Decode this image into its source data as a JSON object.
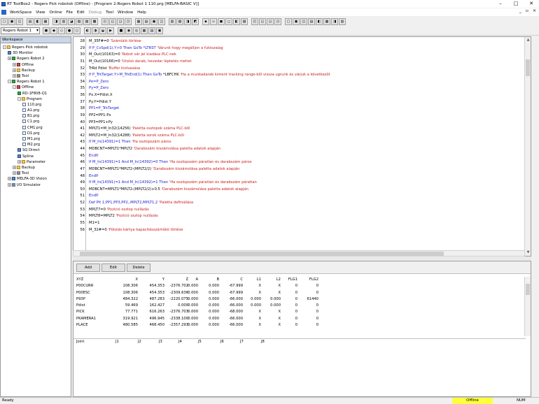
{
  "window": {
    "title": "RT ToolBox2 - Rogers Pick robotok  (Offline) - [Program 2:Rogers Robot 1 110.prg  [MELFA-BASIC V]]",
    "min": "–",
    "max": "□",
    "close": "✕"
  },
  "menu": {
    "items": [
      "WorkSpace",
      "View",
      "Online",
      "File",
      "Edit",
      "Debug",
      "Tool",
      "Window",
      "Help"
    ],
    "mdi_min": "_",
    "mdi_restore": "▫",
    "mdi_close": "×"
  },
  "toolbar": {
    "robot_select": "Rogers Robot 1"
  },
  "workspace": {
    "header": "Workspace",
    "tree": [
      {
        "label": "Rogers Pick robotok",
        "level": 0,
        "icon": "folder",
        "exp": "-"
      },
      {
        "label": "3D Monitor",
        "level": 1,
        "icon": "mon",
        "exp": ""
      },
      {
        "label": "Rogers Robot 2",
        "level": 1,
        "icon": "robot",
        "exp": "+"
      },
      {
        "label": "Offline",
        "level": 2,
        "icon": "plug",
        "exp": "+"
      },
      {
        "label": "Backup",
        "level": 2,
        "icon": "folder",
        "exp": "+"
      },
      {
        "label": "Tool",
        "level": 2,
        "icon": "tool",
        "exp": "+"
      },
      {
        "label": "Rogers Robot 1",
        "level": 1,
        "icon": "robot",
        "exp": "-"
      },
      {
        "label": "Offline",
        "level": 2,
        "icon": "plug",
        "exp": "-"
      },
      {
        "label": "RD-1F808-Q1",
        "level": 3,
        "icon": "robot",
        "exp": ""
      },
      {
        "label": "Program",
        "level": 3,
        "icon": "folder",
        "exp": "-"
      },
      {
        "label": "110.prg",
        "level": 4,
        "icon": "file",
        "exp": ""
      },
      {
        "label": "A1.prg",
        "level": 4,
        "icon": "file",
        "exp": ""
      },
      {
        "label": "B1.prg",
        "level": 4,
        "icon": "file",
        "exp": ""
      },
      {
        "label": "C1.prg",
        "level": 4,
        "icon": "file",
        "exp": ""
      },
      {
        "label": "CM1.prg",
        "level": 4,
        "icon": "file",
        "exp": ""
      },
      {
        "label": "D1.prg",
        "level": 4,
        "icon": "file",
        "exp": ""
      },
      {
        "label": "M1.prg",
        "level": 4,
        "icon": "file",
        "exp": ""
      },
      {
        "label": "M2.prg",
        "level": 4,
        "icon": "file",
        "exp": ""
      },
      {
        "label": "SQ Direct",
        "level": 3,
        "icon": "mon",
        "exp": ""
      },
      {
        "label": "Spline",
        "level": 3,
        "icon": "mon",
        "exp": ""
      },
      {
        "label": "Parameter",
        "level": 3,
        "icon": "folder",
        "exp": "+"
      },
      {
        "label": "Backup",
        "level": 2,
        "icon": "folder",
        "exp": "+"
      },
      {
        "label": "Tool",
        "level": 2,
        "icon": "tool",
        "exp": "+"
      },
      {
        "label": "MELFA-3D Vision",
        "level": 1,
        "icon": "mon",
        "exp": "+"
      },
      {
        "label": "I/O Simulator",
        "level": 1,
        "icon": "sim",
        "exp": "+"
      }
    ]
  },
  "code": [
    {
      "n": "28",
      "parts": [
        [
          "M_35F#=0 ",
          ""
        ],
        [
          "'Számláló törlése",
          "cm"
        ]
      ]
    },
    {
      "n": "29",
      "parts": [
        [
          "If P_CvSpd(1).Y>0 ",
          "kw"
        ],
        [
          "Then GoTo *LTRST ",
          "kw"
        ],
        [
          "'Várunk hogy megálljon a futószalag",
          "cm"
        ]
      ]
    },
    {
      "n": "30",
      "parts": [
        [
          "M_Out(10163)=0 ",
          ""
        ],
        [
          "'Robot vár jel kiadása PLC-nek",
          "cm"
        ]
      ]
    },
    {
      "n": "31",
      "parts": [
        [
          "M_Out(10166)=0 ",
          ""
        ],
        [
          "'Utolsó darab, hevedar léptetés mehet",
          "cm"
        ]
      ]
    },
    {
      "n": "32",
      "parts": [
        [
          "TrRd Pdist ",
          ""
        ],
        [
          "'Buffer kiolvasása",
          "cm"
        ]
      ]
    },
    {
      "n": "33",
      "parts": [
        [
          "If P_TrkTarget.Y>M_TrkEnd(1) Then GoTo ",
          "kw"
        ],
        [
          "*LBFCHK ",
          ""
        ],
        [
          "'Ha a munkadarab kiment tracking range-ből vissza ugrunk és várjuk a következőt",
          "cm"
        ]
      ]
    },
    {
      "n": "34",
      "parts": [
        [
          "Pe=P_Zero",
          "kw"
        ]
      ]
    },
    {
      "n": "35",
      "parts": [
        [
          "Py=P_Zero",
          "kw"
        ]
      ]
    },
    {
      "n": "36",
      "parts": [
        [
          "Px.X=Pdist.X",
          ""
        ]
      ]
    },
    {
      "n": "37",
      "parts": [
        [
          "Py.Y=Pdist.Y",
          ""
        ]
      ]
    },
    {
      "n": "38",
      "parts": [
        [
          "PP1=P_TrkTarget",
          "kw"
        ]
      ]
    },
    {
      "n": "39",
      "parts": [
        [
          "PP2=PP1-Px",
          ""
        ]
      ]
    },
    {
      "n": "40",
      "parts": [
        [
          "PP3=PP1+Py",
          ""
        ]
      ]
    },
    {
      "n": "41",
      "parts": [
        [
          "MPLT1=M_In32(14256) ",
          ""
        ],
        [
          "'Paletta oszlopok száma PLC-ből",
          "cm"
        ]
      ]
    },
    {
      "n": "42",
      "parts": [
        [
          "MPLT2=M_In32(14288) ",
          ""
        ],
        [
          "'Paletta sorok száma PLC-ből",
          "cm"
        ]
      ]
    },
    {
      "n": "43",
      "parts": [
        [
          "If M_In(14391)=1 ",
          "kw"
        ],
        [
          "Then ",
          "kw"
        ],
        [
          "'Ha oszlopszám páros",
          "cm"
        ]
      ]
    },
    {
      "n": "44",
      "parts": [
        [
          " MDBCNT=MPLT1*MPLT2 ",
          ""
        ],
        [
          "'Darabszám kiszámolása paletta adatok alapján",
          "cm"
        ]
      ]
    },
    {
      "n": "45",
      "parts": [
        [
          "EndIf",
          "kw"
        ]
      ]
    },
    {
      "n": "46",
      "parts": [
        [
          "If M_In(14391)=1 And M_In(14392)=0 ",
          "kw"
        ],
        [
          "Then ",
          "kw"
        ],
        [
          "'Ha oszlopszám páratlan és darabszám páros",
          "cm"
        ]
      ]
    },
    {
      "n": "47",
      "parts": [
        [
          " MDBCNT=MPLT1*MPLT2-(MPLT2/2) ",
          ""
        ],
        [
          "'Darabszám kiszámolása paletta adatok alapján",
          "cm"
        ]
      ]
    },
    {
      "n": "48",
      "parts": [
        [
          "EndIf",
          "kw"
        ]
      ]
    },
    {
      "n": "49",
      "parts": [
        [
          "If M_In(14391)=1 And M_In(14392)=1 ",
          "kw"
        ],
        [
          "Then ",
          "kw"
        ],
        [
          "'Ha oszlopszám páratlan és darabszám páratlan",
          "cm"
        ]
      ]
    },
    {
      "n": "50",
      "parts": [
        [
          " MDBCNT=MPLT1*MPLT2-(MPLT2/2)+0.5 ",
          ""
        ],
        [
          "'Darabszám kiszámolása paletta adatok alapján",
          "cm"
        ]
      ]
    },
    {
      "n": "51",
      "parts": [
        [
          "EndIf",
          "kw"
        ]
      ]
    },
    {
      "n": "52",
      "parts": [
        [
          "Def Plt 1,PP1,PP3,PP2,,MPLT2,MPLT1,2 ",
          "kw"
        ],
        [
          "'Paletta definiálása",
          "cm"
        ]
      ]
    },
    {
      "n": "53",
      "parts": [
        [
          "MPLT7=0 ",
          ""
        ],
        [
          "'Pozíció oszlop nullázás",
          "cm"
        ]
      ]
    },
    {
      "n": "54",
      "parts": [
        [
          "MPLT8=MPLT2 ",
          ""
        ],
        [
          "'Pozíció oszlop nullázás",
          "cm"
        ]
      ]
    },
    {
      "n": "55",
      "parts": [
        [
          "M1=1",
          ""
        ]
      ]
    },
    {
      "n": "56",
      "parts": [
        [
          "M_32#=0 ",
          ""
        ],
        [
          "'Pótolás kártya kapacitásszámláló törlése",
          "cm"
        ]
      ]
    }
  ],
  "positions": {
    "buttons": [
      "Add",
      "Edit",
      "Delete"
    ],
    "columns": [
      "XYZ",
      "X",
      "Y",
      "Z",
      "A",
      "B",
      "C",
      "L1",
      "L2",
      "FLG1",
      "FLG2"
    ],
    "rows": [
      [
        "P00CURR",
        "108.306",
        "454.353",
        "-2376.702",
        "0.000",
        "0.000",
        "-67.999",
        "X",
        "X",
        "0",
        "0"
      ],
      [
        "P00ESC",
        "108.306",
        "454.353",
        "-2309.636",
        "0.000",
        "0.000",
        "-67.999",
        "X",
        "X",
        "0",
        "0"
      ],
      [
        "P93P",
        "484.322",
        "487.283",
        "-2220.075",
        "0.000",
        "0.000",
        "-66.000",
        "0.000",
        "0.000",
        "0",
        "61440"
      ],
      [
        "Pdist",
        "59.469",
        "162.427",
        "0.000",
        "0.000",
        "0.000",
        "-66.000",
        "0.000",
        "0.000",
        "0",
        "0"
      ],
      [
        "PICK",
        "77.771",
        "616.263",
        "-2376.703",
        "0.000",
        "0.000",
        "-68.000",
        "X",
        "X",
        "0",
        "0"
      ],
      [
        "PKAMERA1",
        "319.921",
        "496.945",
        "-2338.100",
        "0.000",
        "0.000",
        "-66.000",
        "X",
        "X",
        "0",
        "0"
      ],
      [
        "PLACE",
        "480.585",
        "468.450",
        "-2357.293",
        "0.000",
        "0.000",
        "-66.000",
        "X",
        "X",
        "0",
        "0"
      ]
    ],
    "joint": [
      "Joint",
      "J1",
      "J2",
      "J3",
      "J4",
      "J5",
      "J6",
      "J7",
      "J8"
    ]
  },
  "status": {
    "ready": "Ready",
    "offline": "Offline",
    "num": "NUM"
  },
  "colors": {
    "offline_bg": "#ffff40",
    "keyword": "#1a1ad0",
    "comment": "#c81e1e"
  }
}
